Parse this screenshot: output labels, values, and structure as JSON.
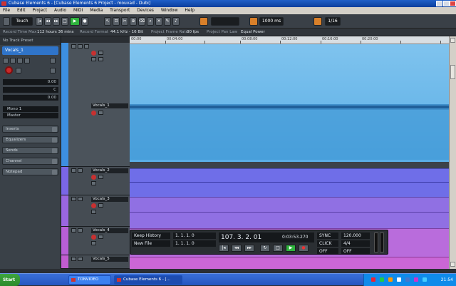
{
  "window": {
    "title": "Cubase Elements 6 - [Cubase Elements 6 Project - mouvad - Dubi]"
  },
  "menu": [
    "File",
    "Edit",
    "Project",
    "Audio",
    "MIDI",
    "Media",
    "Transport",
    "Devices",
    "Window",
    "Help"
  ],
  "toolbar": {
    "touch_mode": "Touch",
    "snap_value": "1/16",
    "quantize_value": "1000 ms"
  },
  "infoline": {
    "record_time_max_label": "Record Time Max",
    "record_time_max_value": "112 hours 36 mins",
    "record_format_label": "Record Format",
    "record_format_value": "44.1 kHz - 16 Bit",
    "frame_rate_label": "Project Frame Rate",
    "frame_rate_value": "30 fps",
    "pan_law_label": "Project Pan Law",
    "pan_law_value": "Equal Power"
  },
  "inspector": {
    "header": "No Track Preset",
    "selected_track": "Vocals_1",
    "values": [
      "0.00",
      "C",
      "0.00"
    ],
    "routing_in": "Mono 1",
    "routing_out": "Master",
    "sections": [
      "Inserts",
      "Equalizers",
      "Sends",
      "Channel",
      "Notepad"
    ]
  },
  "tracks": [
    {
      "name": "Vocals_1",
      "color": "#3d8fe0"
    },
    {
      "name": "Vocals_2",
      "color": "#7a66e6"
    },
    {
      "name": "Vocals_3",
      "color": "#9a66e0"
    },
    {
      "name": "Vocals_4",
      "color": "#b85fd6"
    },
    {
      "name": "Vocals_5",
      "color": "#c25cd0"
    }
  ],
  "ruler": {
    "marks": [
      "00:00",
      "00:04:00",
      "00:08:00",
      "00:12:00",
      "00:16:00",
      "00:20:00"
    ]
  },
  "transport": {
    "keep_history": "Keep History",
    "new_file": "New File",
    "position_primary": "107. 3. 2. 01",
    "position_secondary": "0:03:53.270",
    "left_locator": "1. 1. 1. 0",
    "right_locator": "1. 1. 1. 0",
    "sync": "SYNC",
    "tempo": "120.000",
    "signature": "4/4",
    "click": "CLICK",
    "off": "OFF",
    "mode": "OFF"
  },
  "taskbar": {
    "start_label": "Start",
    "tasks": [
      "TONVIDEO",
      "Cubase Elements 6 - [..."
    ],
    "clock": "21:54"
  }
}
